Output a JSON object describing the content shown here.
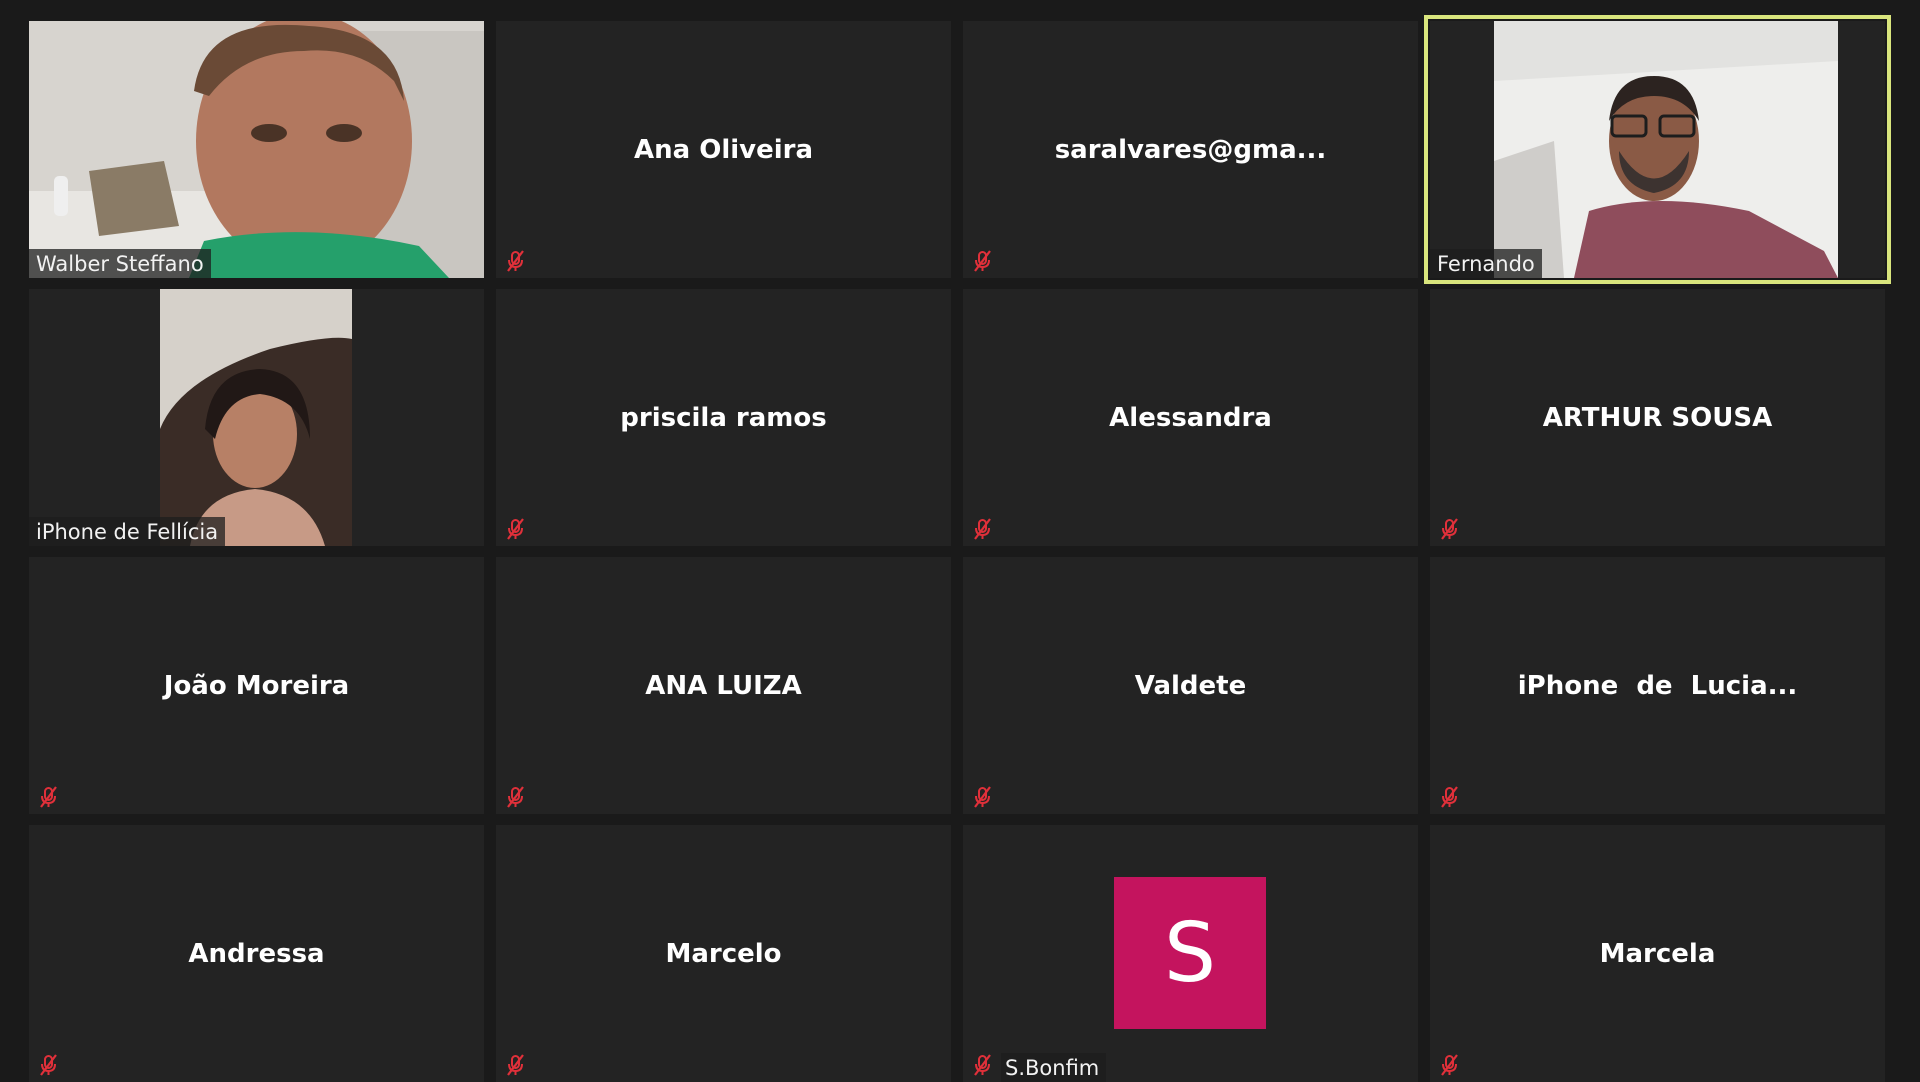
{
  "participants": [
    {
      "name": "Walber Steffano",
      "type": "video",
      "muted": false
    },
    {
      "name": "Ana Oliveira",
      "type": "name",
      "muted": true
    },
    {
      "name": "saralvares@gma...",
      "type": "name",
      "muted": true
    },
    {
      "name": "Fernando",
      "type": "video",
      "muted": false,
      "active_speaker": true
    },
    {
      "name": "iPhone de Fellícia",
      "type": "video",
      "muted": false
    },
    {
      "name": "priscila ramos",
      "type": "name",
      "muted": true
    },
    {
      "name": "Alessandra",
      "type": "name",
      "muted": true
    },
    {
      "name": "ARTHUR SOUSA",
      "type": "name",
      "muted": true
    },
    {
      "name": "João Moreira",
      "type": "name",
      "muted": true
    },
    {
      "name": "ANA LUIZA",
      "type": "name",
      "muted": true
    },
    {
      "name": "Valdete",
      "type": "name",
      "muted": true
    },
    {
      "name": "iPhone  de  Lucia...",
      "type": "name",
      "muted": true
    },
    {
      "name": "Andressa",
      "type": "name",
      "muted": true
    },
    {
      "name": "Marcelo",
      "type": "name",
      "muted": true
    },
    {
      "name": "S.Bonfim",
      "type": "avatar",
      "avatar_letter": "S",
      "avatar_color": "#c4145e",
      "muted": true
    },
    {
      "name": "Marcela",
      "type": "name",
      "muted": true
    }
  ],
  "colors": {
    "background": "#1a1a1a",
    "tile": "#232323",
    "active_speaker_border": "#d9e57d",
    "muted_icon": "#e0303a"
  },
  "icons": {
    "muted": "microphone-muted-icon"
  }
}
